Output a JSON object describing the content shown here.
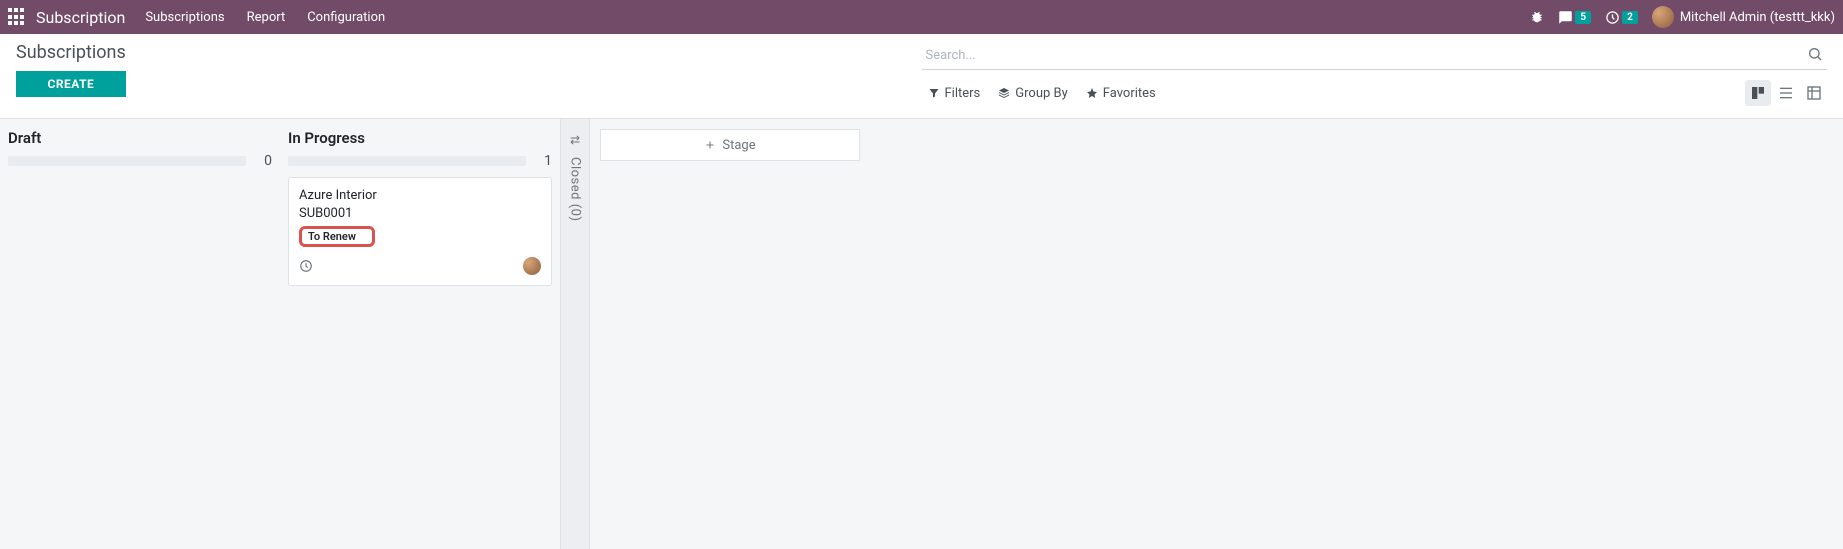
{
  "navbar": {
    "brand": "Subscription",
    "menu": [
      "Subscriptions",
      "Report",
      "Configuration"
    ],
    "messages_badge": "5",
    "activities_badge": "2",
    "user_name": "Mitchell Admin (testtt_kkk)"
  },
  "control_panel": {
    "breadcrumb": "Subscriptions",
    "create_label": "CREATE",
    "search_placeholder": "Search...",
    "filters_label": "Filters",
    "groupby_label": "Group By",
    "favorites_label": "Favorites"
  },
  "kanban": {
    "columns": [
      {
        "title": "Draft",
        "count": "0",
        "cards": []
      },
      {
        "title": "In Progress",
        "count": "1",
        "cards": [
          {
            "partner": "Azure Interior",
            "code": "SUB0001",
            "badge": "To Renew"
          }
        ]
      }
    ],
    "folded": {
      "title": "Closed",
      "count": "0"
    },
    "add_stage_label": "Stage"
  }
}
